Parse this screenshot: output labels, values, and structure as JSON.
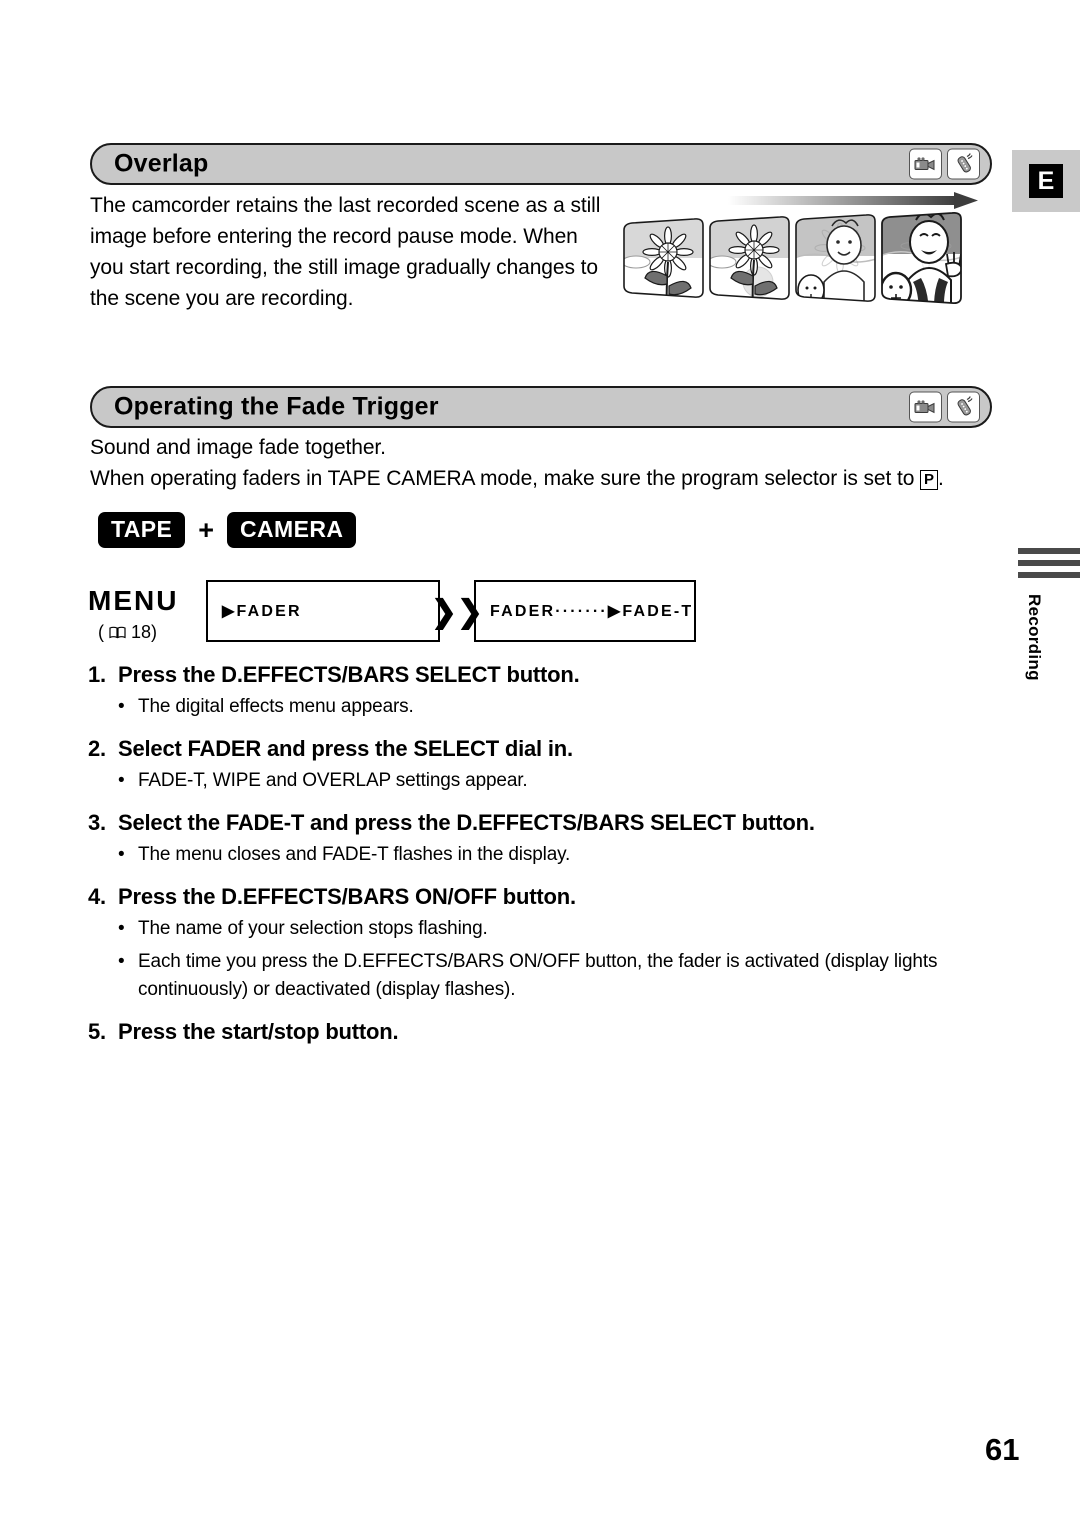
{
  "page": {
    "number": "61",
    "edge_tab_letter": "E",
    "side_tab_label": "Recording"
  },
  "sections": [
    {
      "title": "Overlap",
      "icons": [
        "camcorder-icon",
        "remote-control-icon"
      ],
      "body": "The camcorder retains the last recorded scene as a still image before entering the record pause mode. When you start recording, the still image gradually changes to the scene you are recording."
    },
    {
      "title": "Operating the Fade Trigger",
      "icons": [
        "camcorder-icon",
        "remote-control-icon"
      ],
      "body_line1": "Sound and image fade together.",
      "body_line2_before": "When operating faders in TAPE CAMERA mode, make sure the program selector is set to ",
      "program_selector_symbol": "P",
      "body_line2_after": "."
    }
  ],
  "mode_badges": {
    "first": "TAPE",
    "plus": "+",
    "second": "CAMERA"
  },
  "menu": {
    "label": "MENU",
    "page_reference": "( 18)",
    "page_reference_number": "18",
    "box1_text": "FADER",
    "box1_marker": "▶",
    "separator": "❯❯",
    "box2_text": "FADER·······▶FADE-T"
  },
  "steps": [
    {
      "num": "1.",
      "title": "Press the D.EFFECTS/BARS SELECT button.",
      "bullets": [
        "The digital effects menu appears."
      ]
    },
    {
      "num": "2.",
      "title": "Select FADER and press the SELECT dial in.",
      "bullets": [
        "FADE-T, WIPE and OVERLAP settings appear."
      ]
    },
    {
      "num": "3.",
      "title": "Select the FADE-T and press the D.EFFECTS/BARS SELECT button.",
      "bullets": [
        "The menu closes and FADE-T flashes in the display."
      ]
    },
    {
      "num": "4.",
      "title": "Press the D.EFFECTS/BARS ON/OFF button.",
      "bullets": [
        "The name of your selection stops flashing.",
        "Each time you press the D.EFFECTS/BARS ON/OFF button, the fader is activated (display lights continuously) or deactivated (display flashes)."
      ]
    },
    {
      "num": "5.",
      "title": "Press the start/stop button.",
      "bullets": []
    }
  ],
  "bullet_char": "•"
}
